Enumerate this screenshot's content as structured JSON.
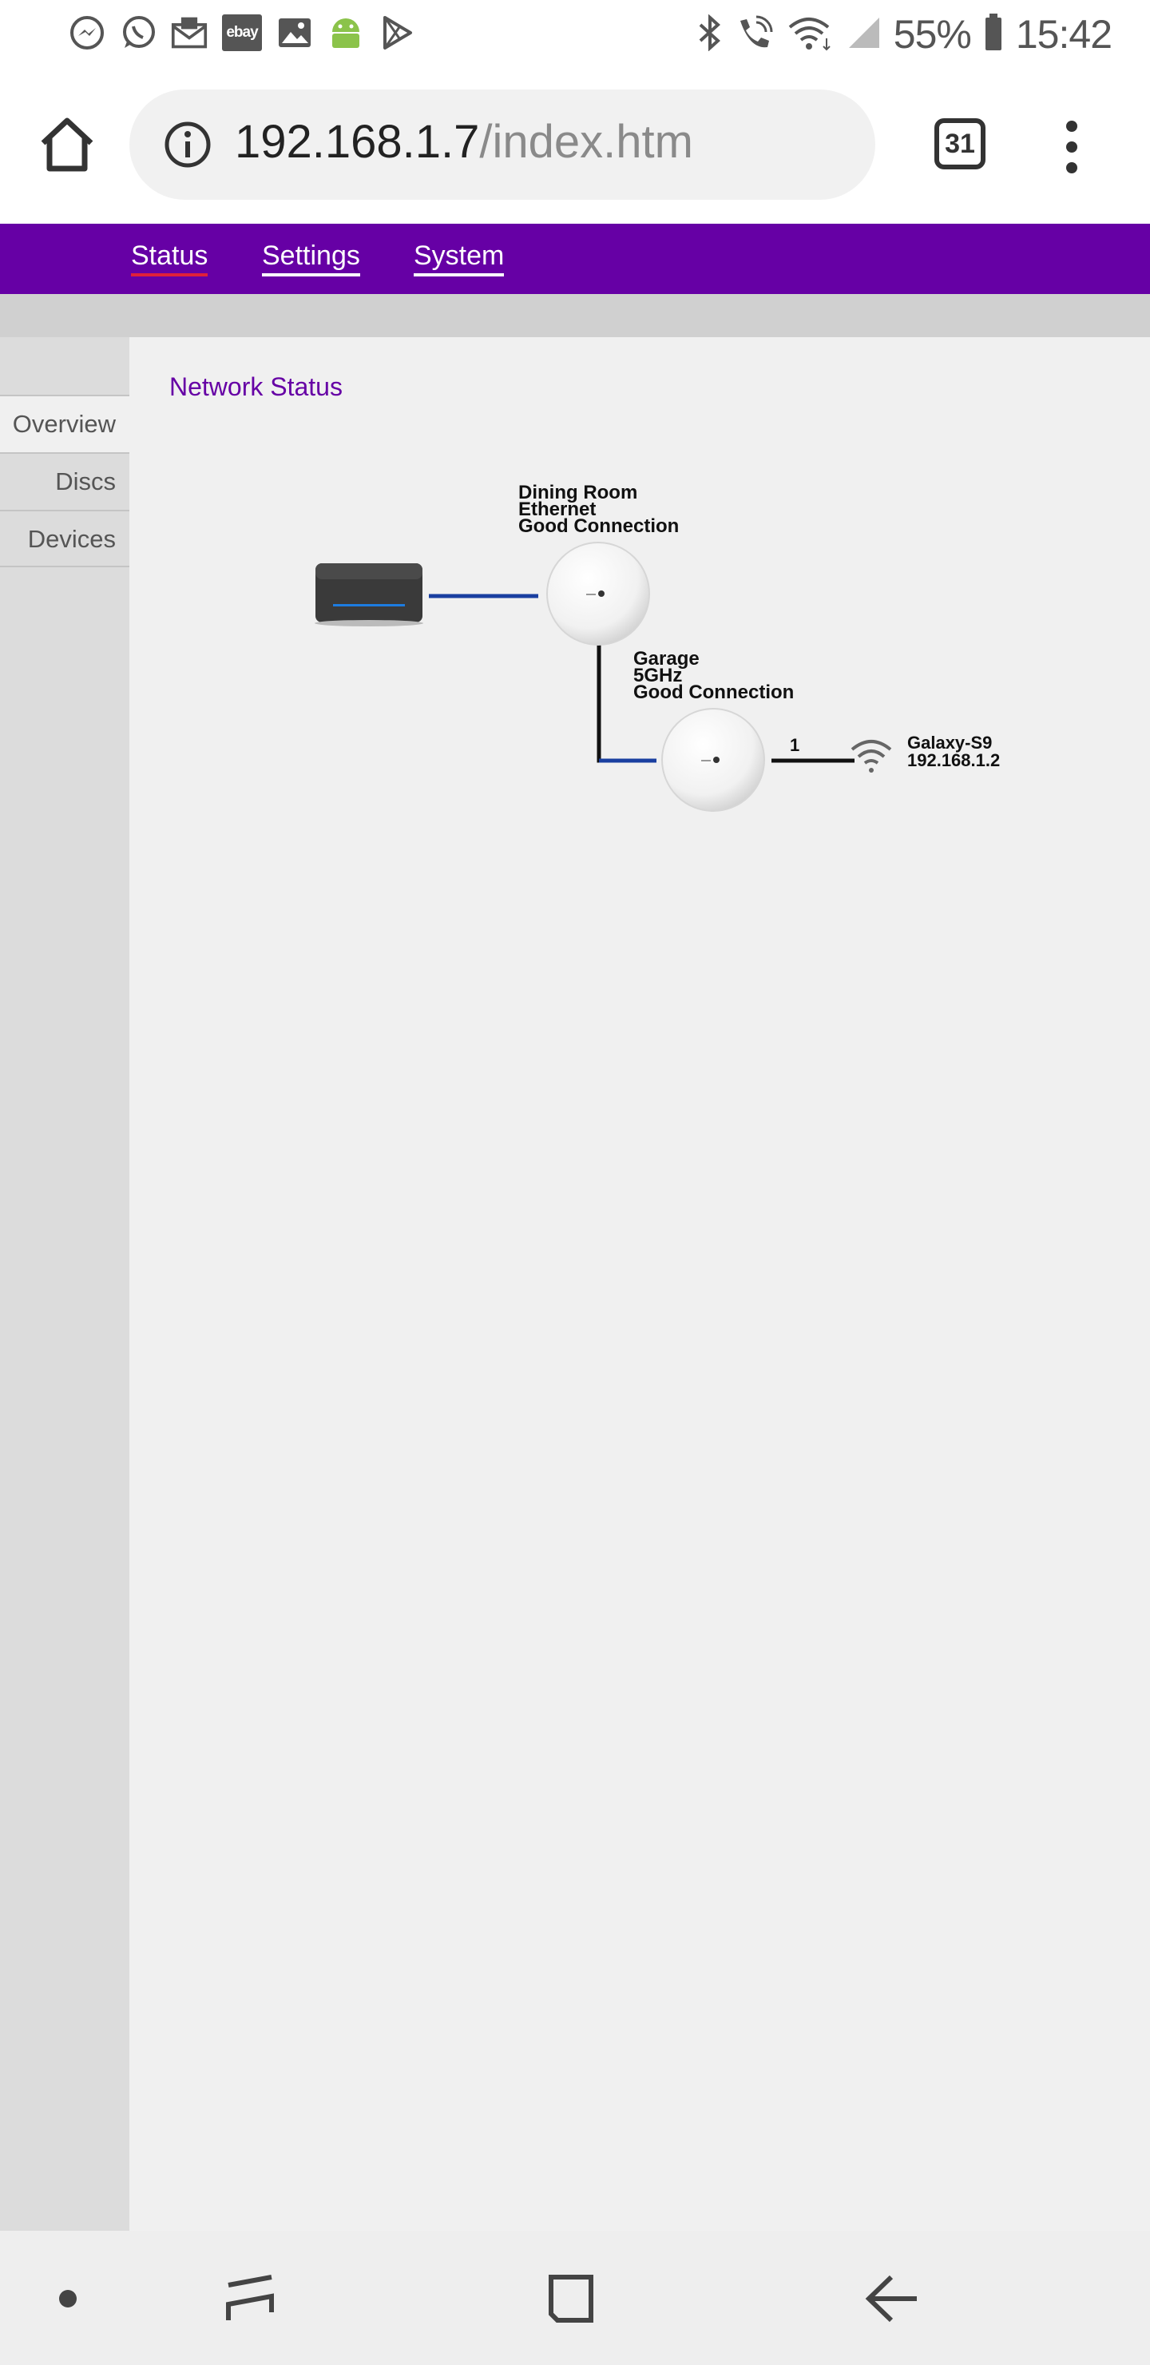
{
  "status_bar": {
    "left_icons": [
      "messenger-icon",
      "whatsapp-icon",
      "mail-notification-icon",
      "ebay-icon",
      "gallery-icon",
      "android-icon",
      "play-store-icon"
    ],
    "ebay_label": "ebay",
    "battery_percent": "55%",
    "time": "15:42"
  },
  "browser": {
    "url_host": "192.168.1.7",
    "url_path": "/index.htm",
    "tab_count": "31"
  },
  "nav": {
    "tabs": [
      {
        "label": "Status",
        "active": true
      },
      {
        "label": "Settings",
        "active": false
      },
      {
        "label": "System",
        "active": false
      }
    ]
  },
  "sidebar": {
    "items": [
      {
        "label": "Overview",
        "active": true
      },
      {
        "label": "Discs",
        "active": false
      },
      {
        "label": "Devices",
        "active": false
      }
    ]
  },
  "main": {
    "title": "Network Status"
  },
  "network": {
    "disc1": {
      "name": "Dining Room",
      "link": "Ethernet",
      "status": "Good Connection"
    },
    "disc2": {
      "name": "Garage",
      "link": "5GHz",
      "status": "Good Connection"
    },
    "client_count": "1",
    "device": {
      "name": "Galaxy-S9",
      "ip": "192.168.1.2"
    }
  },
  "colors": {
    "brand_purple": "#6600a5",
    "active_underline": "#e0203a",
    "link_blue": "#1a3fa0"
  }
}
